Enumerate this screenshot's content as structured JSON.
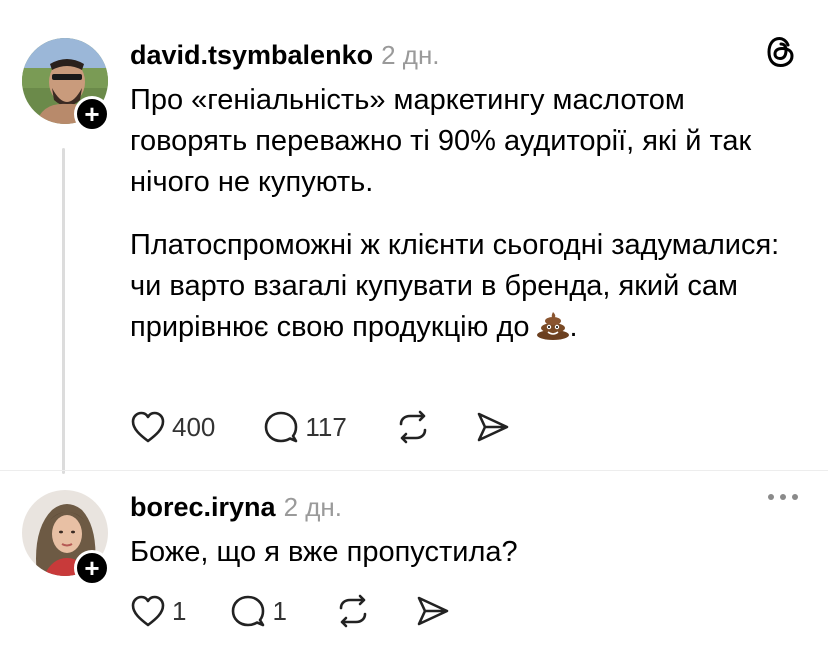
{
  "post1": {
    "username": "david.tsymbalenko",
    "time": "2 дн.",
    "paragraph1": "Про «геніальність» маркетингу маслотом говорять переважно ті 90% аудиторії, які й так нічого не купують.",
    "paragraph2": "Платоспроможні ж клієнти сьогодні задумалися: чи варто взагалі купувати в бренда, який сам прирівнює свою продукцію",
    "paragraph2_end_before": "до",
    "paragraph2_end_after": ".",
    "emoji": "pile-of-poo",
    "likes": "400",
    "comments": "117",
    "follow_symbol": "+"
  },
  "post2": {
    "username": "borec.iryna",
    "time": "2 дн.",
    "text": "Боже, що я вже пропустила?",
    "likes": "1",
    "comments": "1",
    "follow_symbol": "+"
  },
  "icons": {
    "threads": "threads-logo-icon",
    "like": "heart-icon",
    "comment": "comment-bubble-icon",
    "repost": "repost-icon",
    "share": "send-icon",
    "more": "more-dots-icon"
  },
  "colors": {
    "text": "#000000",
    "muted": "#9a9a9a",
    "thread_line": "#dcdcdc"
  }
}
